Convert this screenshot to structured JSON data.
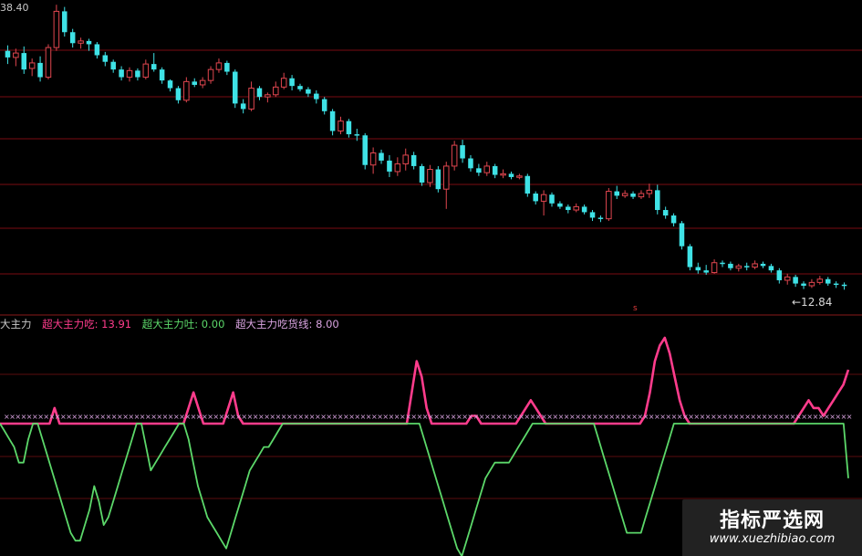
{
  "price_panel": {
    "top_price_label": "38.40",
    "low_marker_label": "←12.84",
    "colors": {
      "up": "#e0464f",
      "down": "#3fe2e6",
      "grid": "#7a0d12"
    }
  },
  "indicator_legend": {
    "name": "大主力",
    "items": [
      {
        "label": "超大主力吃: 13.91",
        "color": "#ff3c8c"
      },
      {
        "label": "超大主力吐: 0.00",
        "color": "#5cd86a"
      },
      {
        "label": "超大主力吃货线: 8.00",
        "color": "#d9a3e0"
      }
    ],
    "flag_text": "s"
  },
  "watermark": {
    "title": "指标严选网",
    "url": "www.xuezhibiao.com"
  },
  "chart_data": [
    {
      "type": "candlestick",
      "title": "",
      "ylim": [
        12.2,
        38.4
      ],
      "candles": [
        {
          "o": 34.6,
          "h": 35.1,
          "l": 33.4,
          "c": 34.0
        },
        {
          "o": 34.0,
          "h": 34.8,
          "l": 33.2,
          "c": 34.4
        },
        {
          "o": 34.4,
          "h": 35.0,
          "l": 32.5,
          "c": 32.9
        },
        {
          "o": 33.0,
          "h": 33.9,
          "l": 32.3,
          "c": 33.5
        },
        {
          "o": 33.5,
          "h": 34.1,
          "l": 31.8,
          "c": 32.2
        },
        {
          "o": 32.2,
          "h": 35.2,
          "l": 32.0,
          "c": 34.9
        },
        {
          "o": 34.9,
          "h": 38.8,
          "l": 34.6,
          "c": 38.2
        },
        {
          "o": 38.2,
          "h": 38.6,
          "l": 35.9,
          "c": 36.3
        },
        {
          "o": 36.3,
          "h": 36.6,
          "l": 34.9,
          "c": 35.3
        },
        {
          "o": 35.3,
          "h": 35.8,
          "l": 34.8,
          "c": 35.5
        },
        {
          "o": 35.5,
          "h": 35.7,
          "l": 34.6,
          "c": 35.2
        },
        {
          "o": 35.2,
          "h": 35.4,
          "l": 33.9,
          "c": 34.2
        },
        {
          "o": 34.2,
          "h": 34.5,
          "l": 33.2,
          "c": 33.6
        },
        {
          "o": 33.6,
          "h": 33.8,
          "l": 32.6,
          "c": 32.9
        },
        {
          "o": 32.9,
          "h": 33.2,
          "l": 31.9,
          "c": 32.2
        },
        {
          "o": 32.2,
          "h": 33.1,
          "l": 31.8,
          "c": 32.8
        },
        {
          "o": 32.8,
          "h": 33.0,
          "l": 31.9,
          "c": 32.2
        },
        {
          "o": 32.2,
          "h": 33.8,
          "l": 32.0,
          "c": 33.4
        },
        {
          "o": 33.4,
          "h": 34.4,
          "l": 32.7,
          "c": 32.9
        },
        {
          "o": 32.9,
          "h": 33.1,
          "l": 31.6,
          "c": 31.9
        },
        {
          "o": 31.9,
          "h": 32.0,
          "l": 30.9,
          "c": 31.2
        },
        {
          "o": 31.2,
          "h": 31.4,
          "l": 29.8,
          "c": 30.1
        },
        {
          "o": 30.1,
          "h": 32.2,
          "l": 29.9,
          "c": 31.8
        },
        {
          "o": 31.8,
          "h": 32.1,
          "l": 31.3,
          "c": 31.5
        },
        {
          "o": 31.5,
          "h": 32.2,
          "l": 31.2,
          "c": 31.9
        },
        {
          "o": 31.9,
          "h": 33.2,
          "l": 31.6,
          "c": 32.9
        },
        {
          "o": 32.9,
          "h": 33.9,
          "l": 32.6,
          "c": 33.5
        },
        {
          "o": 33.5,
          "h": 33.7,
          "l": 32.4,
          "c": 32.7
        },
        {
          "o": 32.7,
          "h": 32.9,
          "l": 29.4,
          "c": 29.8
        },
        {
          "o": 29.8,
          "h": 30.2,
          "l": 28.9,
          "c": 29.3
        },
        {
          "o": 29.3,
          "h": 31.8,
          "l": 29.1,
          "c": 31.2
        },
        {
          "o": 31.2,
          "h": 31.4,
          "l": 30.1,
          "c": 30.4
        },
        {
          "o": 30.4,
          "h": 30.8,
          "l": 29.9,
          "c": 30.6
        },
        {
          "o": 30.6,
          "h": 31.8,
          "l": 30.4,
          "c": 31.3
        },
        {
          "o": 31.3,
          "h": 32.6,
          "l": 31.1,
          "c": 32.1
        },
        {
          "o": 32.1,
          "h": 32.4,
          "l": 31.0,
          "c": 31.4
        },
        {
          "o": 31.4,
          "h": 31.6,
          "l": 30.9,
          "c": 31.1
        },
        {
          "o": 31.1,
          "h": 31.3,
          "l": 30.4,
          "c": 30.7
        },
        {
          "o": 30.7,
          "h": 31.0,
          "l": 29.8,
          "c": 30.2
        },
        {
          "o": 30.2,
          "h": 30.4,
          "l": 28.8,
          "c": 29.1
        },
        {
          "o": 29.1,
          "h": 29.3,
          "l": 26.9,
          "c": 27.3
        },
        {
          "o": 27.3,
          "h": 28.6,
          "l": 27.0,
          "c": 28.2
        },
        {
          "o": 28.2,
          "h": 28.4,
          "l": 26.7,
          "c": 27.0
        },
        {
          "o": 27.0,
          "h": 27.5,
          "l": 26.4,
          "c": 26.9
        },
        {
          "o": 26.9,
          "h": 27.1,
          "l": 23.8,
          "c": 24.2
        },
        {
          "o": 24.2,
          "h": 25.8,
          "l": 23.4,
          "c": 25.3
        },
        {
          "o": 25.3,
          "h": 25.6,
          "l": 24.3,
          "c": 24.6
        },
        {
          "o": 24.6,
          "h": 25.1,
          "l": 23.1,
          "c": 23.6
        },
        {
          "o": 23.6,
          "h": 24.9,
          "l": 23.2,
          "c": 24.3
        },
        {
          "o": 24.3,
          "h": 25.7,
          "l": 23.7,
          "c": 25.1
        },
        {
          "o": 25.1,
          "h": 25.4,
          "l": 23.8,
          "c": 24.1
        },
        {
          "o": 24.1,
          "h": 24.3,
          "l": 22.3,
          "c": 22.6
        },
        {
          "o": 22.6,
          "h": 24.2,
          "l": 22.2,
          "c": 23.8
        },
        {
          "o": 23.8,
          "h": 24.1,
          "l": 21.7,
          "c": 22.0
        },
        {
          "o": 22.0,
          "h": 24.5,
          "l": 20.2,
          "c": 24.1
        },
        {
          "o": 24.1,
          "h": 26.4,
          "l": 23.7,
          "c": 26.0
        },
        {
          "o": 26.0,
          "h": 26.5,
          "l": 24.4,
          "c": 24.8
        },
        {
          "o": 24.8,
          "h": 25.1,
          "l": 23.6,
          "c": 23.9
        },
        {
          "o": 23.9,
          "h": 24.3,
          "l": 23.2,
          "c": 23.5
        },
        {
          "o": 23.5,
          "h": 24.5,
          "l": 23.2,
          "c": 24.1
        },
        {
          "o": 24.1,
          "h": 24.3,
          "l": 23.0,
          "c": 23.3
        },
        {
          "o": 23.3,
          "h": 23.8,
          "l": 23.0,
          "c": 23.4
        },
        {
          "o": 23.4,
          "h": 23.6,
          "l": 22.9,
          "c": 23.1
        },
        {
          "o": 23.1,
          "h": 23.4,
          "l": 22.9,
          "c": 23.2
        },
        {
          "o": 23.2,
          "h": 23.4,
          "l": 21.3,
          "c": 21.6
        },
        {
          "o": 21.6,
          "h": 21.8,
          "l": 20.6,
          "c": 20.9
        },
        {
          "o": 20.9,
          "h": 21.9,
          "l": 19.6,
          "c": 21.5
        },
        {
          "o": 21.5,
          "h": 21.7,
          "l": 20.4,
          "c": 20.7
        },
        {
          "o": 20.7,
          "h": 20.9,
          "l": 20.2,
          "c": 20.4
        },
        {
          "o": 20.4,
          "h": 20.6,
          "l": 19.8,
          "c": 20.1
        },
        {
          "o": 20.1,
          "h": 20.7,
          "l": 19.9,
          "c": 20.4
        },
        {
          "o": 20.4,
          "h": 20.6,
          "l": 19.7,
          "c": 19.9
        },
        {
          "o": 19.9,
          "h": 20.1,
          "l": 19.1,
          "c": 19.4
        },
        {
          "o": 19.4,
          "h": 19.6,
          "l": 19.0,
          "c": 19.3
        },
        {
          "o": 19.3,
          "h": 22.1,
          "l": 19.1,
          "c": 21.8
        },
        {
          "o": 21.8,
          "h": 22.3,
          "l": 21.1,
          "c": 21.4
        },
        {
          "o": 21.4,
          "h": 21.9,
          "l": 21.2,
          "c": 21.6
        },
        {
          "o": 21.6,
          "h": 21.8,
          "l": 21.1,
          "c": 21.3
        },
        {
          "o": 21.3,
          "h": 21.9,
          "l": 21.1,
          "c": 21.6
        },
        {
          "o": 21.6,
          "h": 22.5,
          "l": 21.2,
          "c": 21.9
        },
        {
          "o": 21.9,
          "h": 22.4,
          "l": 19.7,
          "c": 20.1
        },
        {
          "o": 20.1,
          "h": 20.4,
          "l": 19.3,
          "c": 19.6
        },
        {
          "o": 19.6,
          "h": 19.8,
          "l": 18.6,
          "c": 18.9
        },
        {
          "o": 18.9,
          "h": 19.1,
          "l": 16.5,
          "c": 16.8
        },
        {
          "o": 16.8,
          "h": 17.0,
          "l": 14.6,
          "c": 14.9
        },
        {
          "o": 14.9,
          "h": 15.3,
          "l": 14.3,
          "c": 14.6
        },
        {
          "o": 14.6,
          "h": 15.1,
          "l": 14.2,
          "c": 14.4
        },
        {
          "o": 14.4,
          "h": 15.6,
          "l": 14.3,
          "c": 15.3
        },
        {
          "o": 15.3,
          "h": 15.5,
          "l": 14.9,
          "c": 15.2
        },
        {
          "o": 15.2,
          "h": 15.4,
          "l": 14.6,
          "c": 14.8
        },
        {
          "o": 14.8,
          "h": 15.2,
          "l": 14.5,
          "c": 15.0
        },
        {
          "o": 15.0,
          "h": 15.3,
          "l": 14.6,
          "c": 14.9
        },
        {
          "o": 14.9,
          "h": 15.5,
          "l": 14.7,
          "c": 15.2
        },
        {
          "o": 15.2,
          "h": 15.4,
          "l": 14.8,
          "c": 15.0
        },
        {
          "o": 15.0,
          "h": 15.2,
          "l": 14.4,
          "c": 14.6
        },
        {
          "o": 14.6,
          "h": 14.8,
          "l": 13.4,
          "c": 13.7
        },
        {
          "o": 13.7,
          "h": 14.3,
          "l": 13.3,
          "c": 14.0
        },
        {
          "o": 14.0,
          "h": 14.2,
          "l": 13.1,
          "c": 13.4
        },
        {
          "o": 13.4,
          "h": 13.6,
          "l": 12.9,
          "c": 13.2
        },
        {
          "o": 13.2,
          "h": 13.8,
          "l": 13.0,
          "c": 13.5
        },
        {
          "o": 13.5,
          "h": 14.1,
          "l": 13.3,
          "c": 13.8
        },
        {
          "o": 13.8,
          "h": 14.0,
          "l": 13.2,
          "c": 13.4
        },
        {
          "o": 13.4,
          "h": 13.6,
          "l": 13.0,
          "c": 13.3
        },
        {
          "o": 13.3,
          "h": 13.5,
          "l": 12.84,
          "c": 13.2
        }
      ]
    },
    {
      "type": "line",
      "title": "",
      "ylim": [
        0,
        20
      ],
      "series": [
        {
          "name": "超大主力吃",
          "color": "#ff3c8c",
          "values": [
            7,
            7,
            7,
            7,
            7,
            7,
            7,
            7,
            7,
            7,
            7,
            9,
            7,
            7,
            7,
            7,
            7,
            7,
            7,
            7,
            7,
            7,
            7,
            7,
            7,
            7,
            7,
            7,
            7,
            7,
            7,
            7,
            7,
            7,
            7,
            7,
            7,
            7,
            9,
            11,
            9,
            7,
            7,
            7,
            7,
            7,
            9,
            11,
            8,
            7,
            7,
            7,
            7,
            7,
            7,
            7,
            7,
            7,
            7,
            7,
            7,
            7,
            7,
            7,
            7,
            7,
            7,
            7,
            7,
            7,
            7,
            7,
            7,
            7,
            7,
            7,
            7,
            7,
            7,
            7,
            7,
            7,
            7,
            11,
            15,
            13,
            9,
            7,
            7,
            7,
            7,
            7,
            7,
            7,
            7,
            8,
            8,
            7,
            7,
            7,
            7,
            7,
            7,
            7,
            7,
            8,
            9,
            10,
            9,
            8,
            7,
            7,
            7,
            7,
            7,
            7,
            7,
            7,
            7,
            7,
            7,
            7,
            7,
            7,
            7,
            7,
            7,
            7,
            7,
            7,
            8,
            11,
            15,
            17,
            18,
            16,
            13,
            10,
            8,
            7,
            7,
            7,
            7,
            7,
            7,
            7,
            7,
            7,
            7,
            7,
            7,
            7,
            7,
            7,
            7,
            7,
            7,
            7,
            7,
            7,
            7,
            8,
            9,
            10,
            9,
            9,
            8,
            9,
            10,
            11,
            12,
            13.91
          ]
        },
        {
          "name": "超大主力吐",
          "color": "#5cd86a",
          "values": [
            7,
            6,
            5,
            4,
            2,
            2,
            5,
            7,
            7,
            5,
            3,
            1,
            -1,
            -3,
            -5,
            -7,
            -8,
            -8,
            -6,
            -4,
            -1,
            -3,
            -6,
            -5,
            -3,
            -1,
            1,
            3,
            5,
            7,
            7,
            4,
            1,
            2,
            3,
            4,
            5,
            6,
            7,
            7,
            5,
            2,
            -1,
            -3,
            -5,
            -6,
            -7,
            -8,
            -9,
            -7,
            -5,
            -3,
            -1,
            1,
            2,
            3,
            4,
            4,
            5,
            6,
            7,
            7,
            7,
            7,
            7,
            7,
            7,
            7,
            7,
            7,
            7,
            7,
            7,
            7,
            7,
            7,
            7,
            7,
            7,
            7,
            7,
            7,
            7,
            7,
            7,
            7,
            7,
            7,
            7,
            7,
            5,
            3,
            1,
            -1,
            -3,
            -5,
            -7,
            -9,
            -10,
            -8,
            -6,
            -4,
            -2,
            0,
            1,
            2,
            2,
            2,
            2,
            3,
            4,
            5,
            6,
            7,
            7,
            7,
            7,
            7,
            7,
            7,
            7,
            7,
            7,
            7,
            7,
            7,
            7,
            5,
            3,
            1,
            -1,
            -3,
            -5,
            -7,
            -7,
            -7,
            -7,
            -5,
            -3,
            -1,
            1,
            3,
            5,
            7,
            7,
            7,
            7,
            7,
            7,
            7,
            7,
            7,
            7,
            7,
            7,
            7,
            7,
            7,
            7,
            7,
            7,
            7,
            7,
            7,
            7,
            7,
            7,
            7,
            7,
            7,
            7,
            7,
            7,
            7,
            7,
            7,
            7,
            7,
            7,
            7,
            0
          ]
        },
        {
          "name": "超大主力吃货线",
          "color": "#d9a3e0",
          "constant": 8.0
        }
      ]
    }
  ]
}
